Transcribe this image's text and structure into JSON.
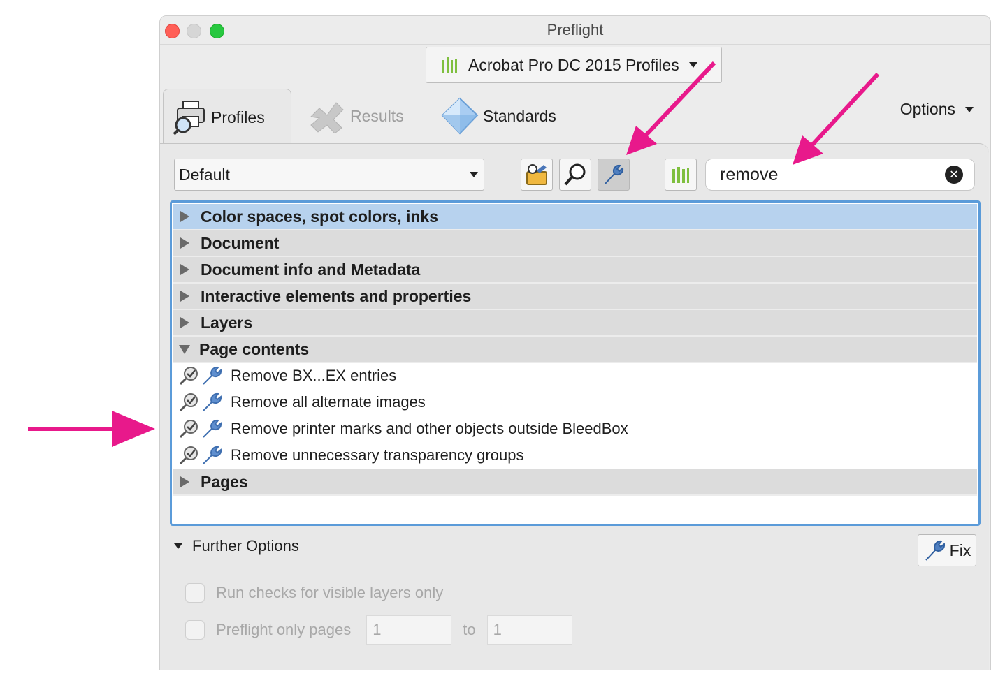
{
  "window": {
    "title": "Preflight"
  },
  "profile_set": {
    "label": "Acrobat Pro DC 2015 Profiles"
  },
  "tabs": [
    {
      "label": "Profiles",
      "state": "active"
    },
    {
      "label": "Results",
      "state": "disabled"
    },
    {
      "label": "Standards",
      "state": "normal"
    }
  ],
  "options_label": "Options",
  "toolbar": {
    "profile_select": "Default",
    "buttons": [
      "profiles-fixups-icon",
      "checks-magnifier-icon",
      "fixups-wrench-icon"
    ],
    "active_button": "fixups-wrench-icon"
  },
  "search": {
    "value": "remove"
  },
  "list": {
    "categories": [
      {
        "label": "Color spaces, spot colors, inks",
        "expanded": false,
        "selected": true
      },
      {
        "label": "Document",
        "expanded": false
      },
      {
        "label": "Document info and Metadata",
        "expanded": false
      },
      {
        "label": "Interactive elements and properties",
        "expanded": false
      },
      {
        "label": "Layers",
        "expanded": false
      },
      {
        "label": "Page contents",
        "expanded": true
      },
      {
        "label": "Pages",
        "expanded": false
      }
    ],
    "items": [
      "Remove BX...EX entries",
      "Remove all alternate images",
      "Remove printer marks and other objects outside BleedBox",
      "Remove unnecessary transparency groups"
    ]
  },
  "further": {
    "label": "Further Options",
    "fix_label": "Fix",
    "visible_layers_label": "Run checks for visible layers only",
    "pages_label": "Preflight only pages",
    "pages_from": "1",
    "pages_to_label": "to",
    "pages_to": "1"
  },
  "colors": {
    "accent": "#5b9bd9",
    "selection": "#b7d2ee",
    "annotation_arrow": "#e8198b"
  }
}
